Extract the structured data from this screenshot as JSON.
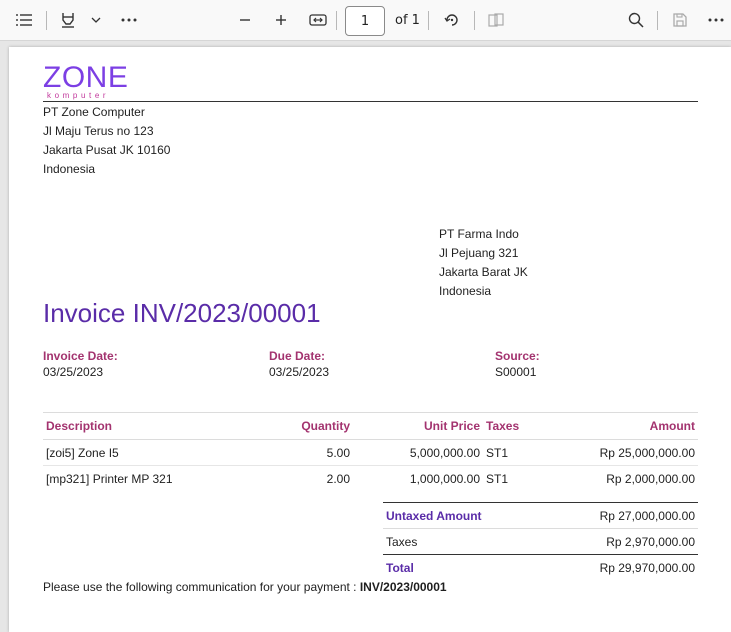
{
  "toolbar": {
    "page_current": "1",
    "page_total": "of 1"
  },
  "company": {
    "logo_main": "ZONE",
    "logo_sub": "komputer",
    "address_lines": [
      "PT Zone Computer",
      "Jl Maju Terus no 123",
      "Jakarta Pusat JK 10160",
      "Indonesia"
    ]
  },
  "customer": {
    "address_lines": [
      "PT Farma Indo",
      "Jl Pejuang 321",
      "Jakarta Barat JK",
      "Indonesia"
    ]
  },
  "invoice": {
    "title": "Invoice INV/2023/00001",
    "date_label": "Invoice Date:",
    "date_value": "03/25/2023",
    "due_label": "Due Date:",
    "due_value": "03/25/2023",
    "source_label": "Source:",
    "source_value": "S00001"
  },
  "lines": {
    "headers": [
      "Description",
      "Quantity",
      "Unit Price",
      "Taxes",
      "Amount"
    ],
    "rows": [
      [
        "[zoi5] Zone I5",
        "5.00",
        "5,000,000.00",
        "ST1",
        "Rp 25,000,000.00"
      ],
      [
        "[mp321] Printer MP 321",
        "2.00",
        "1,000,000.00",
        "ST1",
        "Rp 2,000,000.00"
      ]
    ]
  },
  "totals": {
    "untaxed_label": "Untaxed Amount",
    "untaxed_value": "Rp 27,000,000.00",
    "taxes_label": "Taxes",
    "taxes_value": "Rp 2,970,000.00",
    "total_label": "Total",
    "total_value": "Rp 29,970,000.00"
  },
  "payment": {
    "text": "Please use the following communication for your payment : ",
    "reference": "INV/2023/00001"
  },
  "colors": {
    "brand_purple": "#5a2ca8",
    "label_magenta": "#a3336f"
  }
}
